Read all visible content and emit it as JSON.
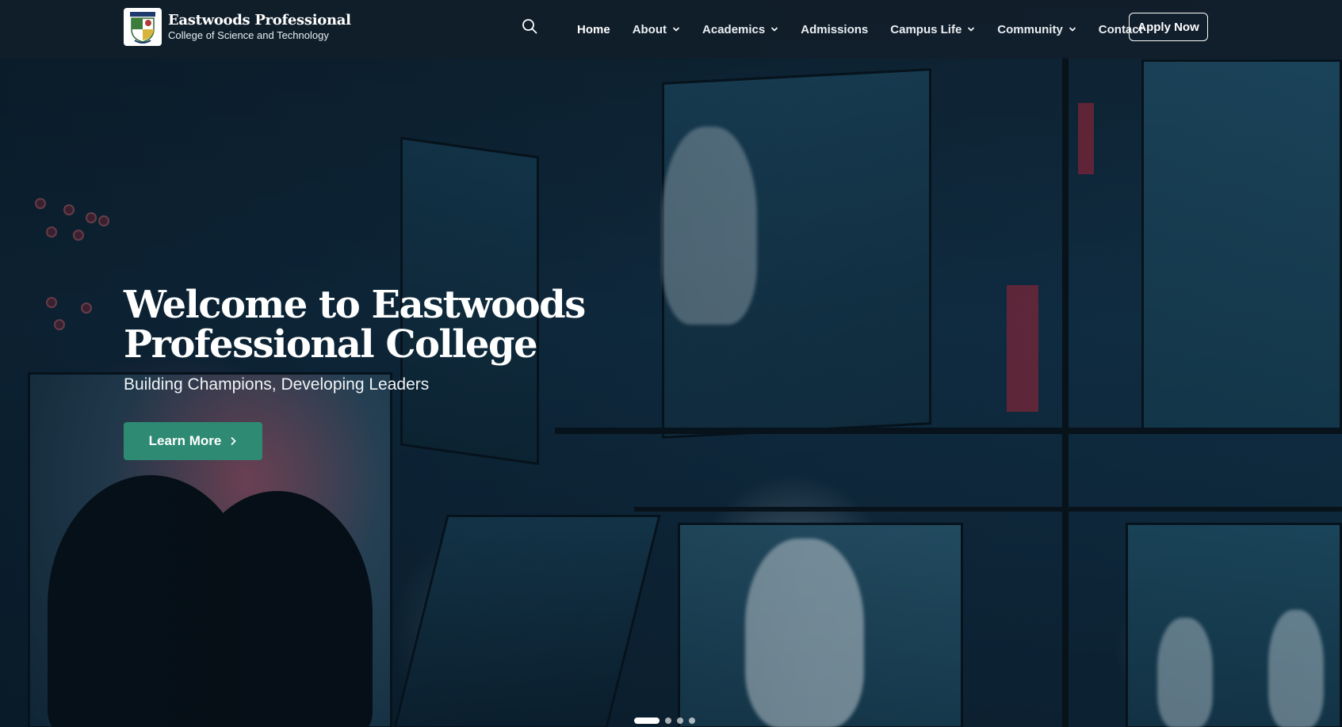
{
  "brand": {
    "title": "Eastwoods Professional",
    "subtitle": "College of Science and Technology"
  },
  "nav": {
    "items": [
      {
        "label": "Home",
        "has_dropdown": false,
        "active": true
      },
      {
        "label": "About",
        "has_dropdown": true,
        "active": false
      },
      {
        "label": "Academics",
        "has_dropdown": true,
        "active": false
      },
      {
        "label": "Admissions",
        "has_dropdown": false,
        "active": false
      },
      {
        "label": "Campus Life",
        "has_dropdown": true,
        "active": false
      },
      {
        "label": "Community",
        "has_dropdown": true,
        "active": false
      },
      {
        "label": "Contact",
        "has_dropdown": false,
        "active": false
      }
    ],
    "apply_label": "Apply Now",
    "search_icon": "search-icon"
  },
  "hero": {
    "title": "Welcome to Eastwoods Professional College",
    "subtitle": "Building Champions, Developing Leaders",
    "cta_label": "Learn More",
    "slide_count": 4,
    "active_slide": 1
  },
  "colors": {
    "navbar_bg": "#111e2a",
    "cta_bg": "#2e8a73",
    "text": "#ffffff"
  }
}
